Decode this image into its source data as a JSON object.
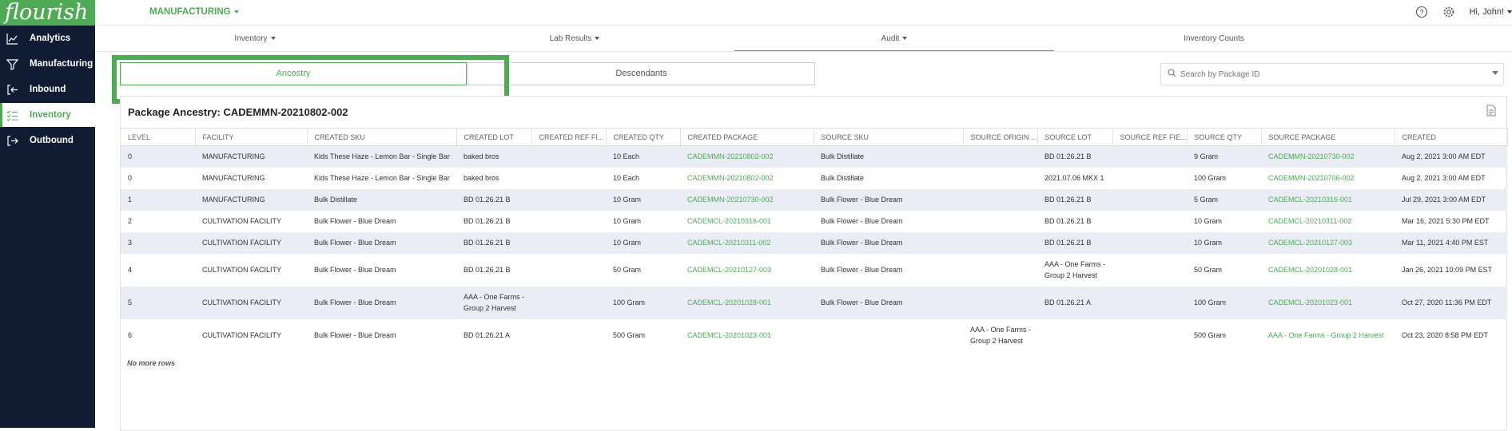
{
  "app": {
    "logo_text": "flourish",
    "brand_color": "#4faa55",
    "sidebar_color": "#0f1c33"
  },
  "sidebar": {
    "items": [
      {
        "label": "Analytics",
        "icon": "chart-line-icon"
      },
      {
        "label": "Manufacturing",
        "icon": "funnel-icon"
      },
      {
        "label": "Inbound",
        "icon": "inbound-icon"
      },
      {
        "label": "Inventory",
        "icon": "checklist-icon",
        "active": true
      },
      {
        "label": "Outbound",
        "icon": "outbound-icon"
      }
    ]
  },
  "header": {
    "department": "MANUFACTURING",
    "greeting": "Hi, John!"
  },
  "subnav": [
    {
      "label": "Inventory"
    },
    {
      "label": "Lab Results"
    },
    {
      "label": "Audit",
      "active": true
    },
    {
      "label": "Inventory Counts"
    }
  ],
  "toggle": {
    "ancestry": "Ancestry",
    "descendants": "Descendants"
  },
  "search": {
    "placeholder": "Search by Package ID"
  },
  "panel": {
    "title": "Package Ancestry: CADEMMN-20210802-002",
    "no_more": "No more rows"
  },
  "table": {
    "headers": [
      "LEVEL",
      "FACILITY",
      "CREATED SKU",
      "CREATED LOT",
      "CREATED REF FI...",
      "CREATED QTY",
      "CREATED PACKAGE",
      "SOURCE SKU",
      "SOURCE ORIGIN ...",
      "SOURCE LOT",
      "SOURCE REF FIE...",
      "SOURCE QTY",
      "SOURCE PACKAGE",
      "CREATED"
    ],
    "rows": [
      [
        "0",
        "MANUFACTURING",
        "Kids These Haze - Lemon Bar - Single Bar",
        "baked bros",
        "",
        "10 Each",
        "CADEMMN-20210802-002",
        "Bulk Distillate",
        "",
        "BD 01.26.21 B",
        "",
        "9 Gram",
        "CADEMMN-20210730-002",
        "Aug 2, 2021 3:00 AM EDT"
      ],
      [
        "0",
        "MANUFACTURING",
        "Kids These Haze - Lemon Bar - Single Bar",
        "baked bros",
        "",
        "10 Each",
        "CADEMMN-20210802-002",
        "Bulk Distillate",
        "",
        "2021.07.06 MKX 1",
        "",
        "100 Gram",
        "CADEMMN-20210706-002",
        "Aug 2, 2021 3:00 AM EDT"
      ],
      [
        "1",
        "MANUFACTURING",
        "Bulk Distillate",
        "BD 01.26.21 B",
        "",
        "10 Gram",
        "CADEMMN-20210730-002",
        "Bulk Flower - Blue Dream",
        "",
        "BD 01.26.21 B",
        "",
        "5 Gram",
        "CADEMCL-20210316-001",
        "Jul 29, 2021 3:00 AM EDT"
      ],
      [
        "2",
        "CULTIVATION FACILITY",
        "Bulk Flower - Blue Dream",
        "BD 01.26.21 B",
        "",
        "10 Gram",
        "CADEMCL-20210316-001",
        "Bulk Flower - Blue Dream",
        "",
        "BD 01.26.21 B",
        "",
        "10 Gram",
        "CADEMCL-20210311-002",
        "Mar 16, 2021 5:30 PM EDT"
      ],
      [
        "3",
        "CULTIVATION FACILITY",
        "Bulk Flower - Blue Dream",
        "BD 01.26.21 B",
        "",
        "10 Gram",
        "CADEMCL-20210311-002",
        "Bulk Flower - Blue Dream",
        "",
        "BD 01.26.21 B",
        "",
        "10 Gram",
        "CADEMCL-20210127-003",
        "Mar 11, 2021 4:40 PM EST"
      ],
      [
        "4",
        "CULTIVATION FACILITY",
        "Bulk Flower - Blue Dream",
        "BD 01.26.21 B",
        "",
        "50 Gram",
        "CADEMCL-20210127-003",
        "Bulk Flower - Blue Dream",
        "",
        "AAA - One Farms - Group 2 Harvest",
        "",
        "50 Gram",
        "CADEMCL-20201028-001",
        "Jan 26, 2021 10:09 PM EST"
      ],
      [
        "5",
        "CULTIVATION FACILITY",
        "Bulk Flower - Blue Dream",
        "AAA - One Farms - Group 2 Harvest",
        "",
        "100 Gram",
        "CADEMCL-20201028-001",
        "Bulk Flower - Blue Dream",
        "",
        "BD 01.26.21 A",
        "",
        "100 Gram",
        "CADEMCL-20201023-001",
        "Oct 27, 2020 11:36 PM EDT"
      ],
      [
        "6",
        "CULTIVATION FACILITY",
        "Bulk Flower - Blue Dream",
        "BD 01.26.21 A",
        "",
        "500 Gram",
        "CADEMCL-20201023-001",
        "",
        "AAA - One Farms - Group 2 Harvest",
        "",
        "",
        "500 Gram",
        "AAA - One Farms - Group 2 Harvest",
        "Oct 23, 2020 8:58 PM EDT"
      ]
    ]
  }
}
